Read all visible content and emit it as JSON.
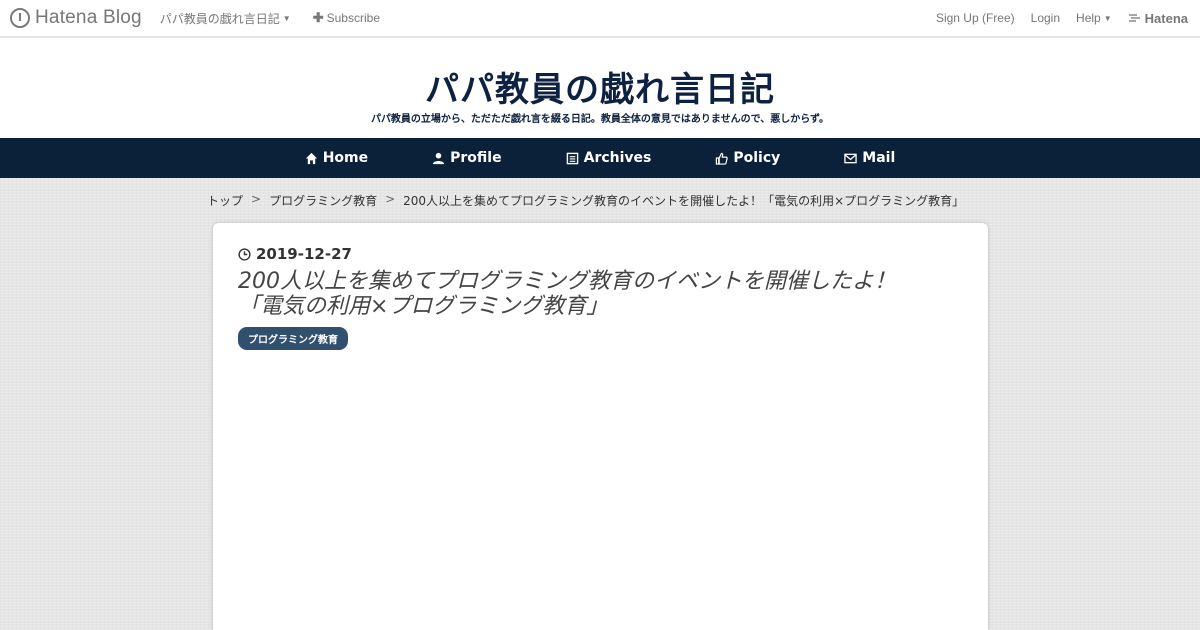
{
  "topbar": {
    "brand": "Hatena Blog",
    "blog_menu": "パパ教員の戯れ言日記",
    "subscribe": "Subscribe",
    "signup": "Sign Up (Free)",
    "login": "Login",
    "help": "Help",
    "hatena": "Hatena"
  },
  "header": {
    "title": "パパ教員の戯れ言日記",
    "description": "パパ教員の立場から、ただただ戯れ言を綴る日記。教員全体の意見ではありませんので、悪しからず。"
  },
  "nav": {
    "items": [
      {
        "label": "Home",
        "icon": "home-icon"
      },
      {
        "label": "Profile",
        "icon": "user-icon"
      },
      {
        "label": "Archives",
        "icon": "archive-icon"
      },
      {
        "label": "Policy",
        "icon": "thumbs-up-icon"
      },
      {
        "label": "Mail",
        "icon": "envelope-icon"
      }
    ]
  },
  "breadcrumb": {
    "items": [
      "トップ",
      "プログラミング教育",
      "200人以上を集めてプログラミング教育のイベントを開催したよ！「電気の利用×プログラミング教育」"
    ],
    "separator": ">"
  },
  "article": {
    "date": "2019-12-27",
    "title_line1": "200人以上を集めてプログラミング教育のイベントを開催したよ！",
    "title_line2": "「電気の利用×プログラミング教育」",
    "category": "プログラミング教育"
  },
  "colors": {
    "nav_bg": "#0b2039",
    "title_color": "#0d2240",
    "badge_bg": "#31506e"
  }
}
